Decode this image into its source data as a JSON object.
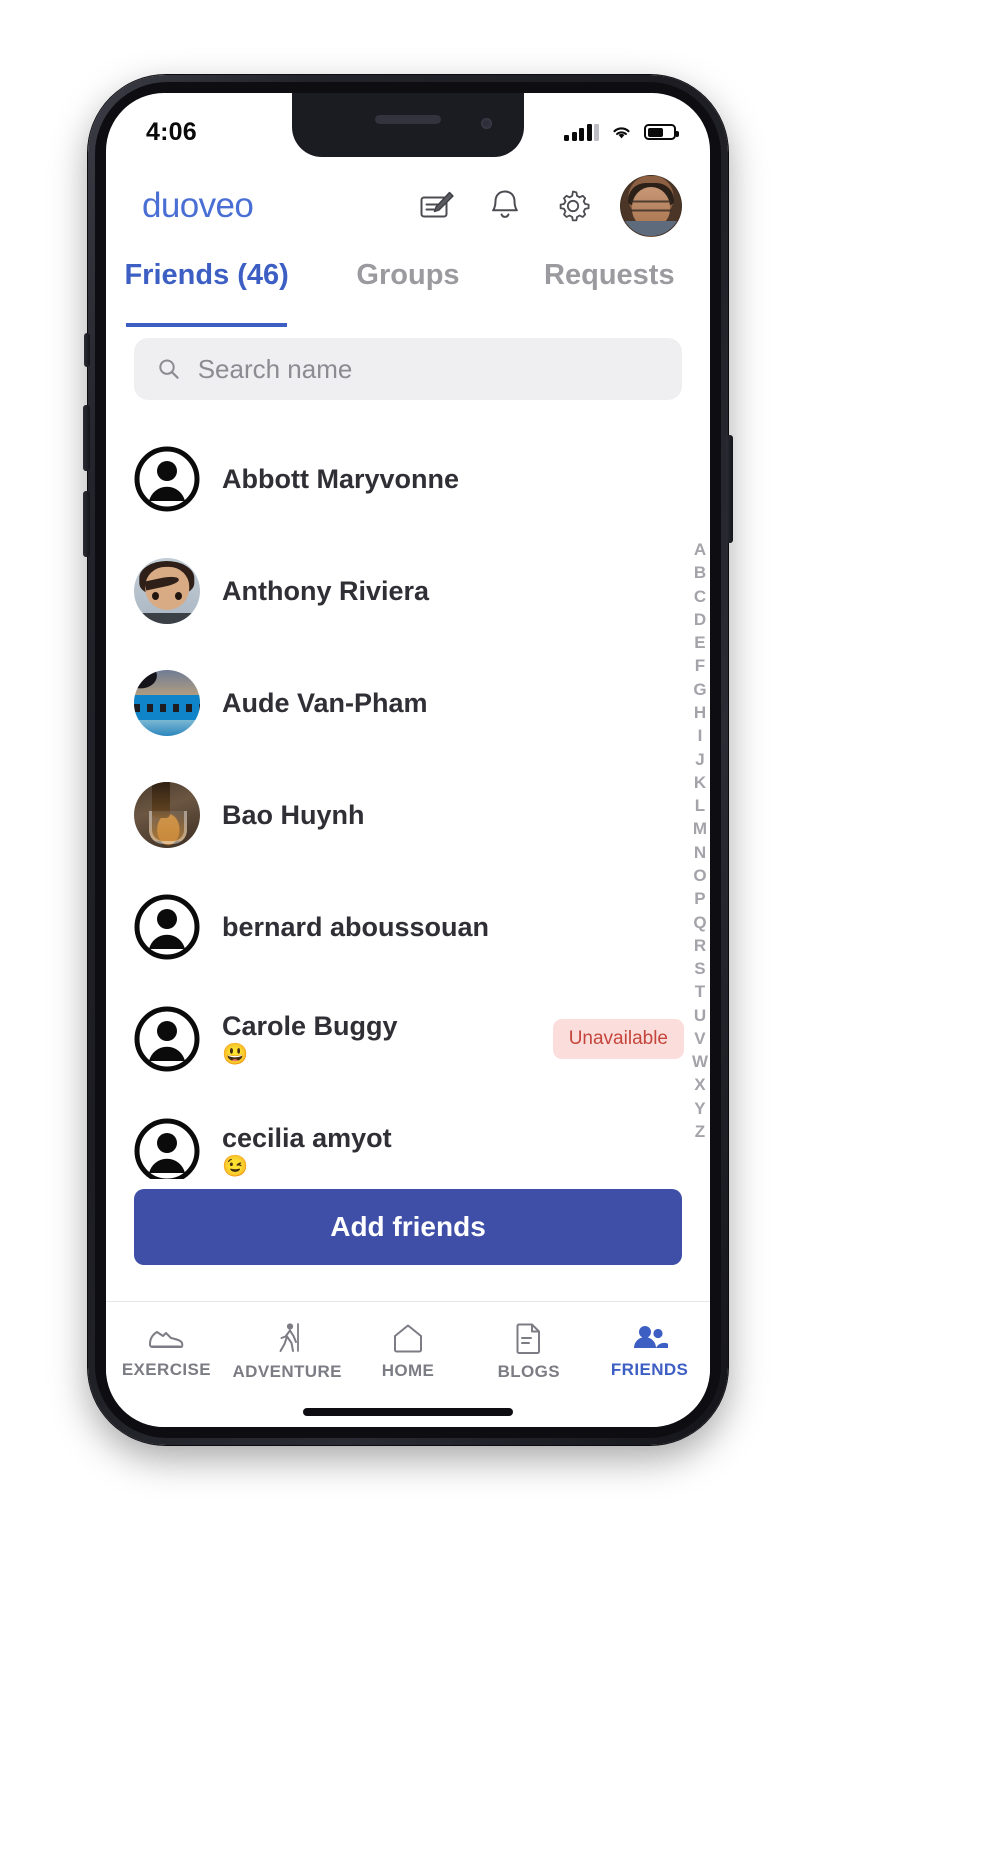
{
  "status_bar": {
    "time": "4:06",
    "signal_icon": "cellular-signal-icon",
    "wifi_icon": "wifi-icon",
    "battery_icon": "battery-icon"
  },
  "header": {
    "brand": "duoveo",
    "compose_icon": "compose-note-icon",
    "notifications_icon": "bell-icon",
    "settings_icon": "gear-icon",
    "avatar_alt": "profile-avatar"
  },
  "tabs": [
    {
      "label": "Friends (46)",
      "active": true
    },
    {
      "label": "Groups",
      "active": false
    },
    {
      "label": "Requests",
      "active": false
    }
  ],
  "search": {
    "placeholder": "Search name",
    "value": "",
    "icon": "search-icon"
  },
  "friends": [
    {
      "name": "Abbott Maryvonne",
      "avatar": "default-person",
      "emoji": "",
      "badge": ""
    },
    {
      "name": "Anthony Riviera",
      "avatar": "cartoon-photo",
      "emoji": "",
      "badge": ""
    },
    {
      "name": "Aude Van-Pham",
      "avatar": "beach-photo",
      "emoji": "",
      "badge": ""
    },
    {
      "name": "Bao Huynh",
      "avatar": "whisky-photo",
      "emoji": "",
      "badge": ""
    },
    {
      "name": "bernard aboussouan",
      "avatar": "default-person",
      "emoji": "",
      "badge": ""
    },
    {
      "name": "Carole Buggy",
      "avatar": "default-person",
      "emoji": "😃",
      "badge": "Unavailable"
    },
    {
      "name": "cecilia amyot",
      "avatar": "default-person",
      "emoji": "😉",
      "badge": ""
    }
  ],
  "alphabet_index": [
    "A",
    "B",
    "C",
    "D",
    "E",
    "F",
    "G",
    "H",
    "I",
    "J",
    "K",
    "L",
    "M",
    "N",
    "O",
    "P",
    "Q",
    "R",
    "S",
    "T",
    "U",
    "V",
    "W",
    "X",
    "Y",
    "Z"
  ],
  "add_friends_button": "Add friends",
  "bottom_nav": [
    {
      "label": "EXERCISE",
      "icon": "shoe-icon",
      "active": false
    },
    {
      "label": "ADVENTURE",
      "icon": "hiker-icon",
      "active": false
    },
    {
      "label": "HOME",
      "icon": "house-icon",
      "active": false
    },
    {
      "label": "BLOGS",
      "icon": "blog-page-icon",
      "active": false
    },
    {
      "label": "FRIENDS",
      "icon": "people-icon",
      "active": true
    }
  ],
  "colors": {
    "accent": "#3d5fc4",
    "button": "#3f4fa8",
    "badge_bg": "#fbdedc",
    "badge_text": "#c4453c",
    "muted": "#9a9a9f"
  }
}
